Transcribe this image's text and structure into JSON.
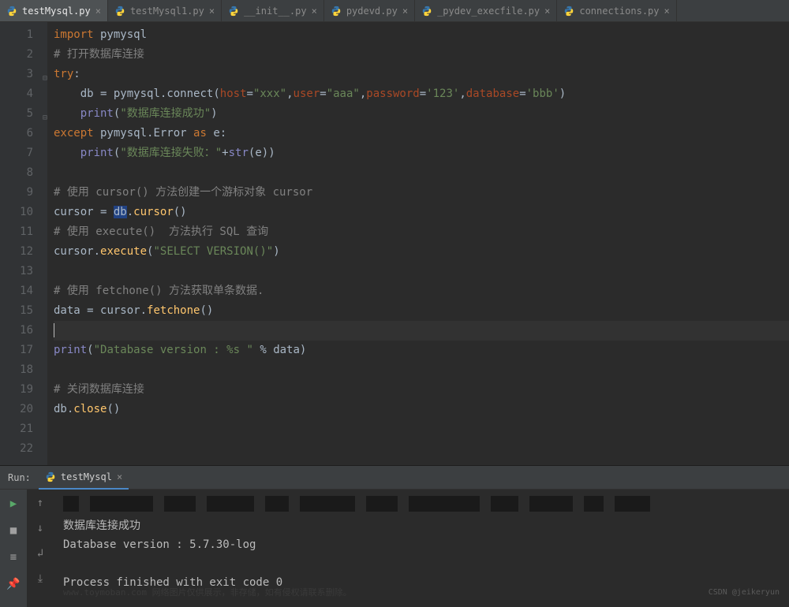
{
  "tabs": [
    {
      "label": "testMysql.py",
      "active": true
    },
    {
      "label": "testMysql1.py",
      "active": false
    },
    {
      "label": "__init__.py",
      "active": false
    },
    {
      "label": "pydevd.py",
      "active": false
    },
    {
      "label": "_pydev_execfile.py",
      "active": false
    },
    {
      "label": "connections.py",
      "active": false
    }
  ],
  "editor": {
    "lines": {
      "l1": {
        "kw": "import",
        "id": " pymysql"
      },
      "l2": {
        "cm": "# 打开数据库连接"
      },
      "l3": {
        "kw": "try",
        "op": ":"
      },
      "l4": {
        "id1": "db ",
        "op1": "= ",
        "id2": "pymysql",
        "op2": ".",
        "fn": "connect",
        "lp": "(",
        "p1": "host",
        "eq": "=",
        "s1": "\"xxx\"",
        "cm1": ",",
        "p2": "user",
        "s2": "\"aaa\"",
        "p3": "password",
        "s3": "'123'",
        "p4": "database",
        "s4": "'bbb'",
        "rp": ")"
      },
      "l5": {
        "pr": "print",
        "lp": "(",
        "s": "\"数据库连接成功\"",
        "rp": ")"
      },
      "l6": {
        "kw1": "except",
        "id": " pymysql",
        "op1": ".",
        "id2": "Error ",
        "kw2": "as",
        "id3": " e",
        "op2": ":"
      },
      "l7": {
        "pr": "print",
        "lp": "(",
        "s": "\"数据库连接失败：\"",
        "op": "+",
        "fn": "str",
        "lp2": "(",
        "id": "e",
        "rp": "))"
      },
      "l9": {
        "cm": "# 使用 cursor() 方法创建一个游标对象 cursor"
      },
      "l10": {
        "id1": "cursor ",
        "op": "= ",
        "hl": "db",
        "op2": ".",
        "fn": "cursor",
        "p": "()"
      },
      "l11": {
        "cm": "# 使用 execute()  方法执行 SQL 查询"
      },
      "l12": {
        "id": "cursor",
        "op": ".",
        "fn": "execute",
        "lp": "(",
        "s": "\"SELECT VERSION()\"",
        "rp": ")"
      },
      "l14": {
        "cm": "# 使用 fetchone() 方法获取单条数据."
      },
      "l15": {
        "id1": "data ",
        "op": "= ",
        "id2": "cursor",
        "op2": ".",
        "fn": "fetchone",
        "p": "()"
      },
      "l17": {
        "pr": "print",
        "lp": "(",
        "s": "\"Database version : %s \"",
        "op": " % ",
        "id": "data",
        "rp": ")"
      },
      "l19": {
        "cm": "# 关闭数据库连接"
      },
      "l20": {
        "id": "db",
        "op": ".",
        "fn": "close",
        "p": "()"
      }
    }
  },
  "run": {
    "label": "Run:",
    "tab": "testMysql",
    "output": {
      "l1": "数据库连接成功",
      "l2": "Database version : 5.7.30-log",
      "l3": "Process finished with exit code 0"
    }
  },
  "watermark": "CSDN @jeikeryun",
  "faint": "www.toymoban.com 网络图片仅供展示，非存储，如有侵权请联系删除。"
}
